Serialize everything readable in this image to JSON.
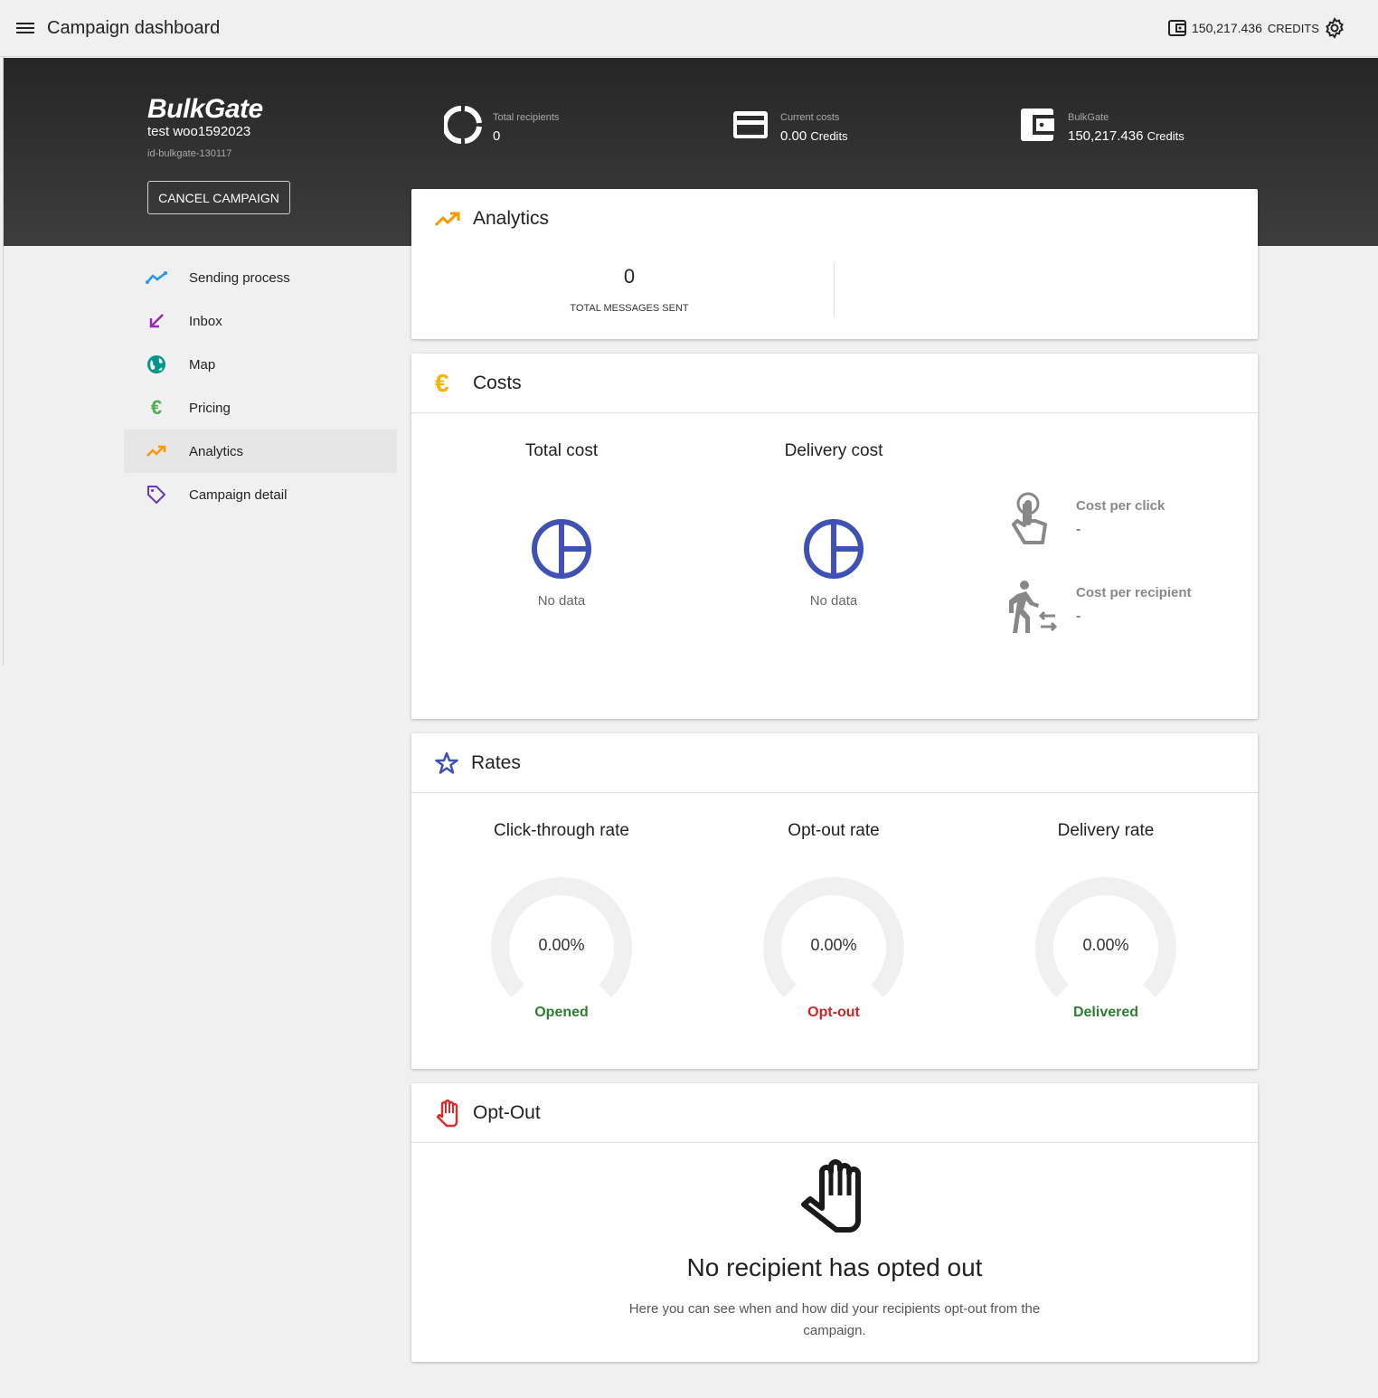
{
  "topbar": {
    "title": "Campaign dashboard",
    "credits_value": "150,217.436",
    "credits_unit": "CREDITS"
  },
  "hero": {
    "logo": "BulkGate",
    "campaign_name": "test woo1592023",
    "campaign_id": "id-bulkgate-130117",
    "cancel_label": "CANCEL CAMPAIGN",
    "stats": [
      {
        "label": "Total recipients",
        "value": "0",
        "unit": ""
      },
      {
        "label": "Current costs",
        "value": "0.00",
        "unit": "Credits"
      },
      {
        "label": "BulkGate",
        "value": "150,217.436",
        "unit": "Credits"
      }
    ]
  },
  "sidebar": {
    "items": [
      {
        "label": "Sending process",
        "icon": "trending-line-icon",
        "color": "#2196f3"
      },
      {
        "label": "Inbox",
        "icon": "arrow-down-left-icon",
        "color": "#9c27b0"
      },
      {
        "label": "Map",
        "icon": "globe-icon",
        "color": "#009688"
      },
      {
        "label": "Pricing",
        "icon": "euro-icon",
        "color": "#4caf50"
      },
      {
        "label": "Analytics",
        "icon": "trending-up-icon",
        "color": "#ff9800",
        "active": true
      },
      {
        "label": "Campaign detail",
        "icon": "tag-icon",
        "color": "#673ab7"
      }
    ]
  },
  "analytics": {
    "title": "Analytics",
    "total_sent_value": "0",
    "total_sent_label": "TOTAL MESSAGES SENT"
  },
  "costs": {
    "title": "Costs",
    "total_cost_title": "Total cost",
    "total_cost_nodata": "No data",
    "delivery_cost_title": "Delivery cost",
    "delivery_cost_nodata": "No data",
    "cost_per_click_label": "Cost per click",
    "cost_per_click_value": "-",
    "cost_per_recipient_label": "Cost per recipient",
    "cost_per_recipient_value": "-"
  },
  "rates": {
    "title": "Rates",
    "items": [
      {
        "title": "Click-through rate",
        "value": "0.00%",
        "fraction": 0,
        "label": "Opened",
        "color": "#2e7d32"
      },
      {
        "title": "Opt-out rate",
        "value": "0.00%",
        "fraction": 0,
        "label": "Opt-out",
        "color": "#c62828"
      },
      {
        "title": "Delivery rate",
        "value": "0.00%",
        "fraction": 0,
        "label": "Delivered",
        "color": "#2e7d32"
      }
    ]
  },
  "optout": {
    "title": "Opt-Out",
    "empty_title": "No recipient has opted out",
    "empty_text": "Here you can see when and how did your recipients opt-out from the campaign."
  },
  "colors": {
    "accent_blue": "#3f51b5",
    "analytics_orange": "#ff9800",
    "euro_yellow": "#f5b400",
    "optout_red": "#d32f2f"
  }
}
